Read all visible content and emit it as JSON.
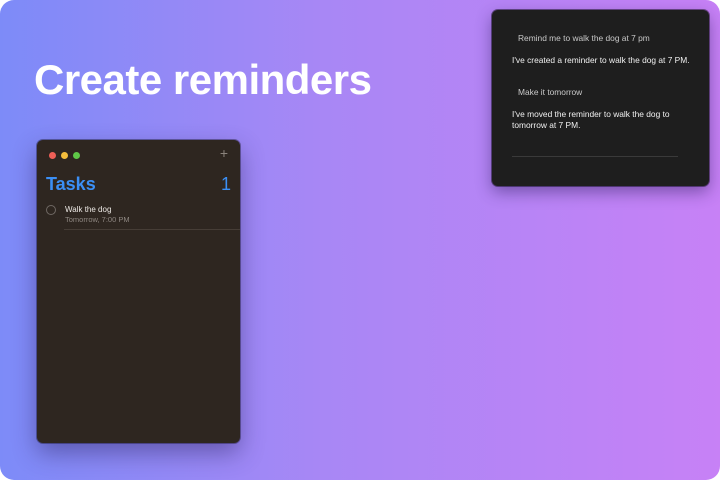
{
  "headline": "Create reminders",
  "reminders_window": {
    "add_label": "+",
    "list_title": "Tasks",
    "list_count": "1",
    "tasks": [
      {
        "title": "Walk the dog",
        "due": "Tomorrow, 7:00 PM"
      }
    ]
  },
  "assistant": {
    "messages": [
      {
        "role": "user",
        "text": "Remind me to walk the dog at 7 pm"
      },
      {
        "role": "assistant",
        "text": "I've created a reminder to walk the dog at 7 PM."
      },
      {
        "role": "user",
        "text": "Make it tomorrow"
      },
      {
        "role": "assistant",
        "text": "I've moved the reminder to walk the dog to tomorrow at 7 PM."
      }
    ]
  },
  "colors": {
    "gradient_start": "#7d8bf8",
    "gradient_end": "#c781f6",
    "accent_blue": "#3b8ff5",
    "window_bg": "#2e2620",
    "assistant_bg": "#1e1e1e",
    "traffic_red": "#ee5f57",
    "traffic_yellow": "#f4bd3c",
    "traffic_green": "#5fc847"
  },
  "icons": {
    "close": "window-close-dot",
    "minimize": "window-minimize-dot",
    "zoom": "window-zoom-dot",
    "add": "plus-icon",
    "checkbox": "empty-circle-checkbox"
  }
}
